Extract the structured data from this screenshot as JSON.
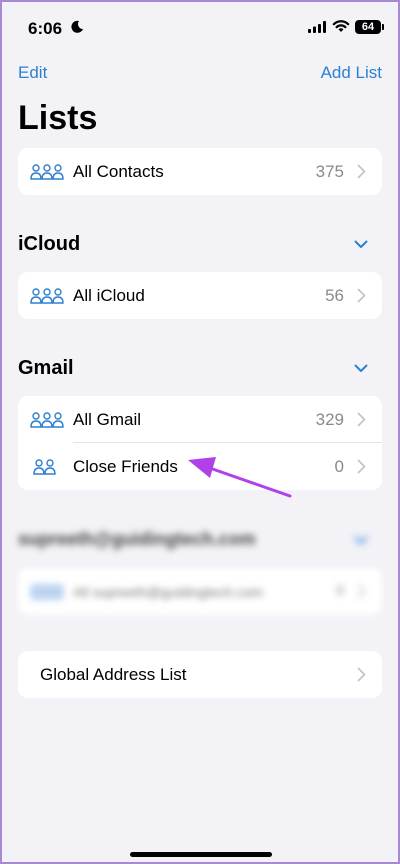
{
  "status_bar": {
    "time": "6:06",
    "battery": "64"
  },
  "nav": {
    "edit_label": "Edit",
    "add_list_label": "Add List"
  },
  "page_title": "Lists",
  "all_contacts": {
    "label": "All Contacts",
    "count": "375"
  },
  "icloud": {
    "header": "iCloud",
    "items": [
      {
        "label": "All iCloud",
        "count": "56"
      }
    ]
  },
  "gmail": {
    "header": "Gmail",
    "items": [
      {
        "label": "All Gmail",
        "count": "329"
      },
      {
        "label": "Close Friends",
        "count": "0"
      }
    ]
  },
  "other_account": {
    "header": "supreeth@guidingtech.com",
    "items": [
      {
        "label": "All supreeth@guidingtech.com",
        "count": "0"
      }
    ]
  },
  "global_address_list": {
    "label": "Global Address List"
  },
  "colors": {
    "accent": "#2f80d1",
    "background": "#f2f2f7",
    "annotation_arrow": "#b040e8"
  }
}
